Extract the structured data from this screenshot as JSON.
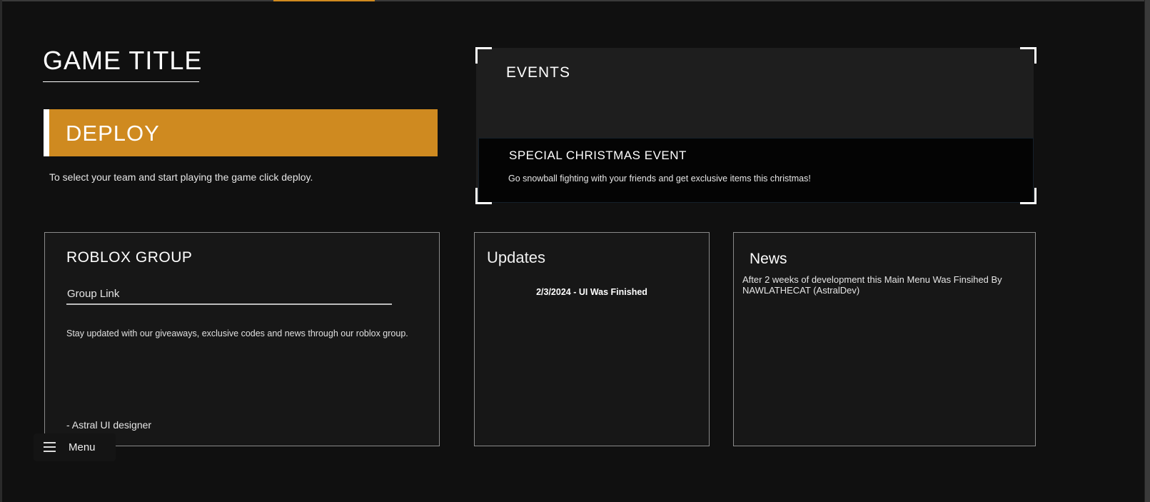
{
  "header": {
    "game_title": "GAME TITLE"
  },
  "deploy": {
    "label": "DEPLOY",
    "description": "To select your team and start playing the game click deploy."
  },
  "events": {
    "title": "EVENTS",
    "items": [
      {
        "name": "SPECIAL CHRISTMAS EVENT",
        "description": "Go snowball fighting with your friends and get exclusive items this christmas!"
      }
    ]
  },
  "roblox_group": {
    "title": "ROBLOX GROUP",
    "link_label": "Group Link",
    "description": "Stay updated with our giveaways, exclusive codes and news through our roblox group.",
    "signature": "- Astral UI designer"
  },
  "updates": {
    "title": "Updates",
    "items": [
      "2/3/2024 - UI Was Finished"
    ]
  },
  "news": {
    "title": "News",
    "body": "After 2 weeks of development this Main Menu Was Finsihed By NAWLATHECAT (AstralDev)"
  },
  "menu": {
    "label": "Menu",
    "icon": "hamburger-icon"
  },
  "colors": {
    "accent": "#cf8a20",
    "background": "#101010",
    "panel": "#171717"
  }
}
